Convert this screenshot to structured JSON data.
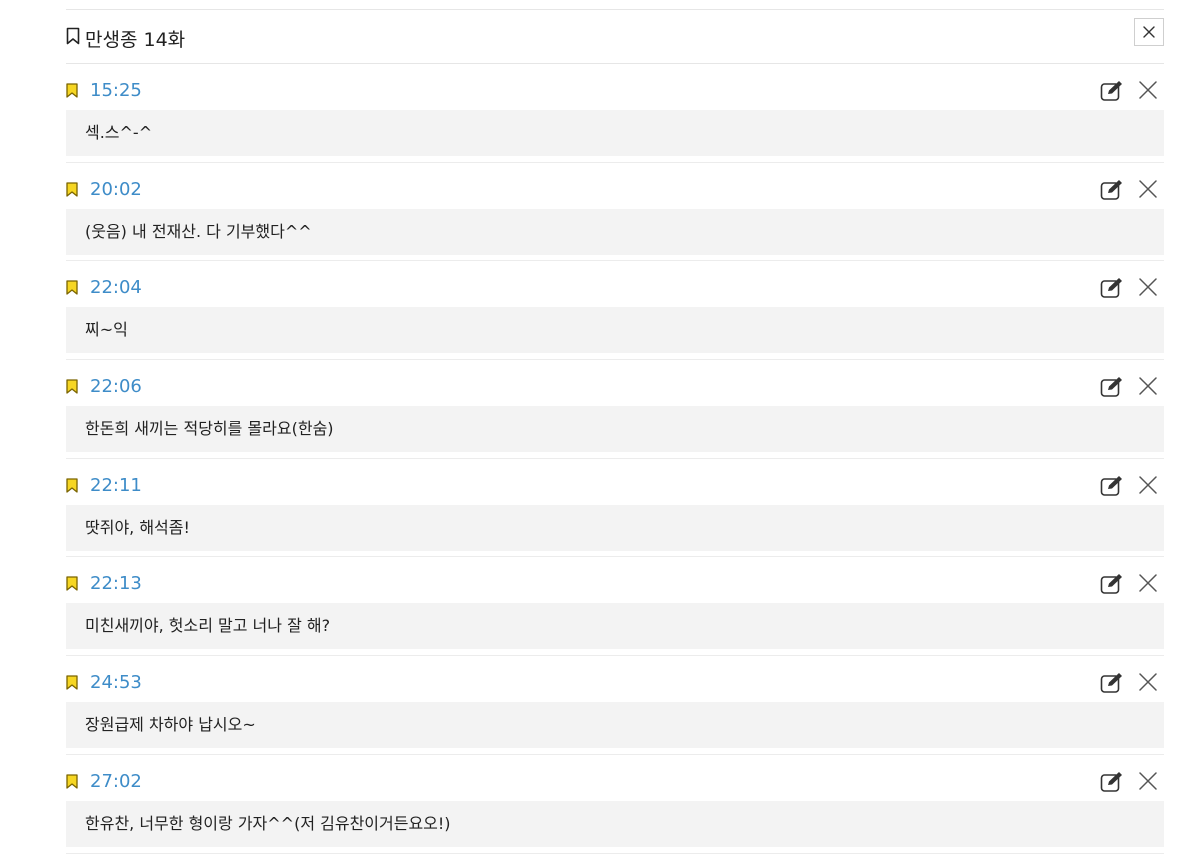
{
  "header": {
    "title": "만생종 14화",
    "title_icon": "bookmark-outline-icon",
    "close_icon": "close-icon"
  },
  "colors": {
    "timestamp": "#3e8cc8",
    "bookmark_fill": "#f6d623",
    "bookmark_stroke": "#7a6400",
    "note_background": "#f3f3f3"
  },
  "entries": [
    {
      "time": "15:25",
      "note": "섹.스^-^"
    },
    {
      "time": "20:02",
      "note": "(웃음) 내 전재산. 다 기부했다^^"
    },
    {
      "time": "22:04",
      "note": "찌~익"
    },
    {
      "time": "22:06",
      "note": "한돈희 새끼는 적당히를 몰라요(한숨)"
    },
    {
      "time": "22:11",
      "note": "땃쥐야, 해석좀!"
    },
    {
      "time": "22:13",
      "note": "미친새끼야, 헛소리 말고 너나 잘 해?"
    },
    {
      "time": "24:53",
      "note": "장원급제 차하야 납시오~"
    },
    {
      "time": "27:02",
      "note": "한유찬, 너무한 형이랑 가자^^(저 김유찬이거든요오!)"
    }
  ],
  "entry_icons": {
    "marker": "bookmark-flag-icon",
    "edit": "edit-icon",
    "delete": "close-icon"
  }
}
